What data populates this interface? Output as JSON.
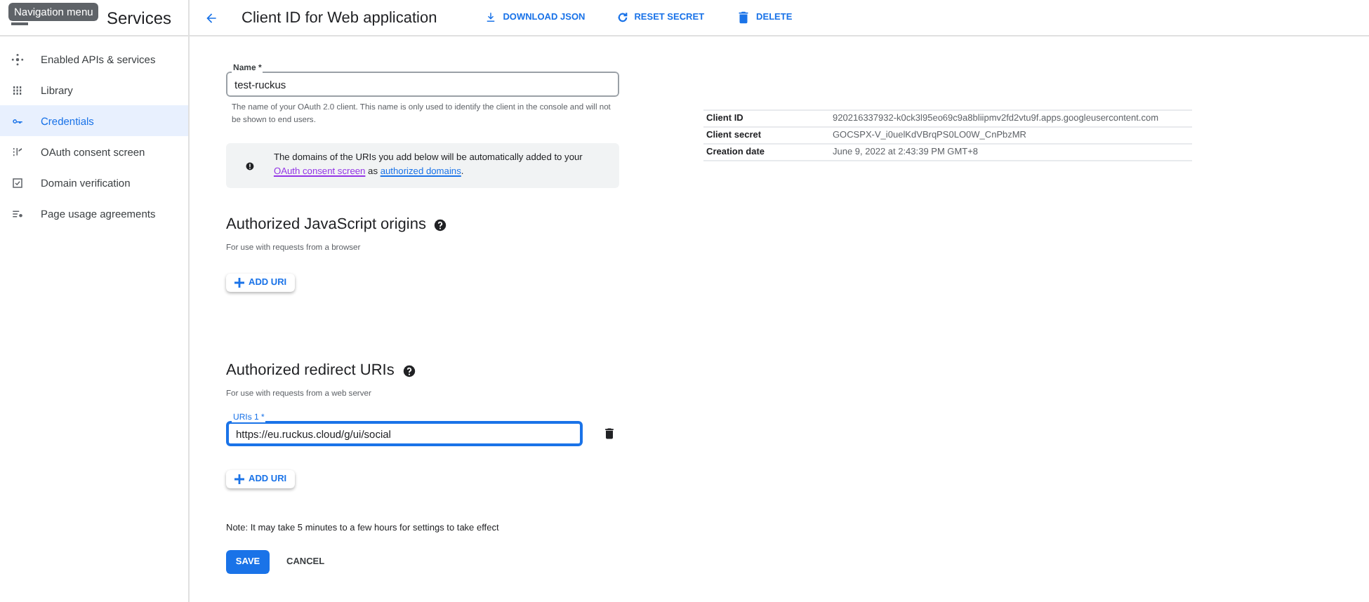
{
  "tooltip": "Navigation menu",
  "sidebar": {
    "title": "Services",
    "items": [
      {
        "label": "Enabled APIs & services",
        "selected": false
      },
      {
        "label": "Library",
        "selected": false
      },
      {
        "label": "Credentials",
        "selected": true
      },
      {
        "label": "OAuth consent screen",
        "selected": false
      },
      {
        "label": "Domain verification",
        "selected": false
      },
      {
        "label": "Page usage agreements",
        "selected": false
      }
    ]
  },
  "header": {
    "title": "Client ID for Web application",
    "actions": [
      {
        "label": "DOWNLOAD JSON"
      },
      {
        "label": "RESET SECRET"
      },
      {
        "label": "DELETE"
      }
    ]
  },
  "name_field": {
    "label": "Name *",
    "value": "test-ruckus",
    "hint": "The name of your OAuth 2.0 client. This name is only used to identify the client in the console and will not be shown to end users."
  },
  "notice": {
    "before": "The domains of the URIs you add below will be automatically added to your ",
    "link_1": "OAuth consent screen",
    "middle": " as ",
    "link_2": "authorized domains",
    "after": "."
  },
  "js_origins": {
    "title": "Authorized JavaScript origins",
    "subtitle": "For use with requests from a browser",
    "add_button": "ADD URI"
  },
  "redirect_uris": {
    "title": "Authorized redirect URIs",
    "subtitle": "For use with requests from a web server",
    "uris": [
      {
        "label": "URIs 1 *",
        "value": "https://eu.ruckus.cloud/g/ui/social"
      }
    ],
    "add_button": "ADD URI"
  },
  "note": "Note: It may take 5 minutes to a few hours for settings to take effect",
  "buttons": {
    "save": "SAVE",
    "cancel": "CANCEL"
  },
  "details": [
    {
      "label": "Client ID",
      "value": "920216337932-k0ck3l95eo69c9a8bliipmv2fd2vtu9f.apps.googleusercontent.com"
    },
    {
      "label": "Client secret",
      "value": "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"
    },
    {
      "label": "Creation date",
      "value": "June 9, 2022 at 2:43:39 PM GMT+8"
    }
  ]
}
